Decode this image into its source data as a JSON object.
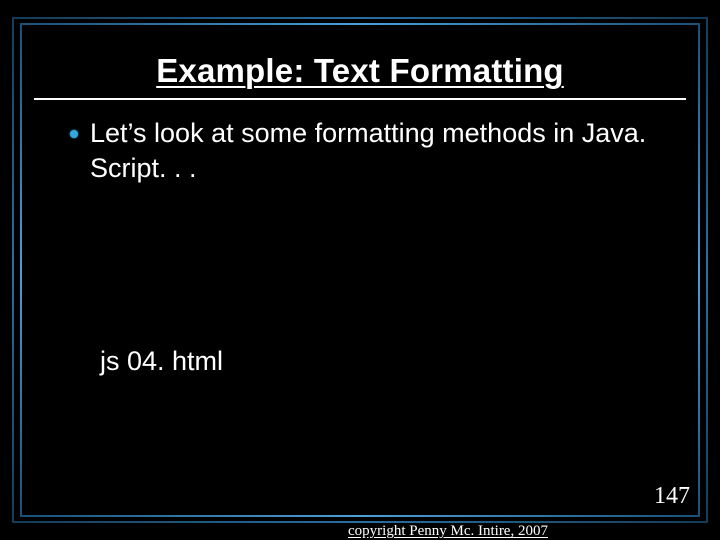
{
  "slide": {
    "title": "Example: Text Formatting",
    "bullet1": "Let’s look at some formatting methods in Java. Script. . .",
    "file_ref": "js 04. html",
    "page_number": "147",
    "copyright": "copyright Penny Mc. Intire, 2007"
  }
}
